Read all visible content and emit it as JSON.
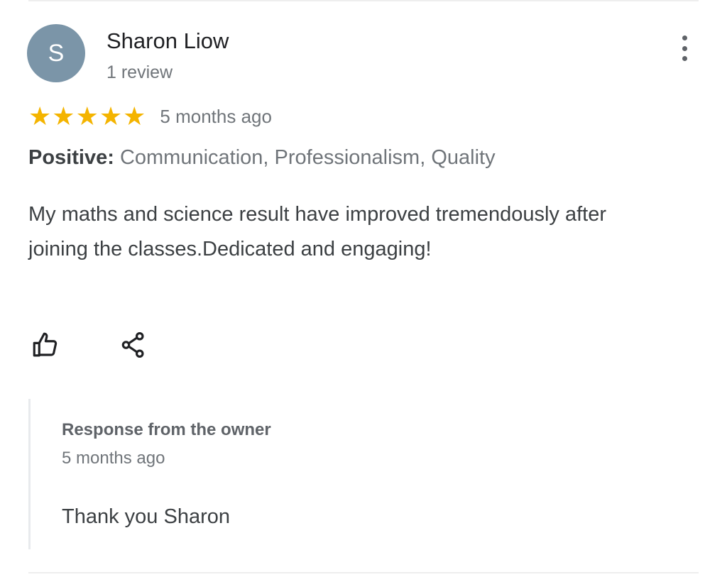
{
  "review": {
    "avatar_initial": "S",
    "avatar_color": "#7b95a8",
    "reviewer_name": "Sharon Liow",
    "review_count": "1 review",
    "more_icon": "more-vertical-icon",
    "rating": 5,
    "rating_max": 5,
    "star_color": "#f4b400",
    "date": "5 months ago",
    "attribute_label": "Positive:",
    "attribute_values": "Communication, Professionalism, Quality",
    "text": "My maths and science result have improved tremendously after joining the classes.Dedicated and engaging!",
    "actions": {
      "like_icon": "thumbs-up-icon",
      "share_icon": "share-icon"
    }
  },
  "owner_response": {
    "title": "Response from the owner",
    "date": "5 months ago",
    "text": "Thank you Sharon"
  }
}
